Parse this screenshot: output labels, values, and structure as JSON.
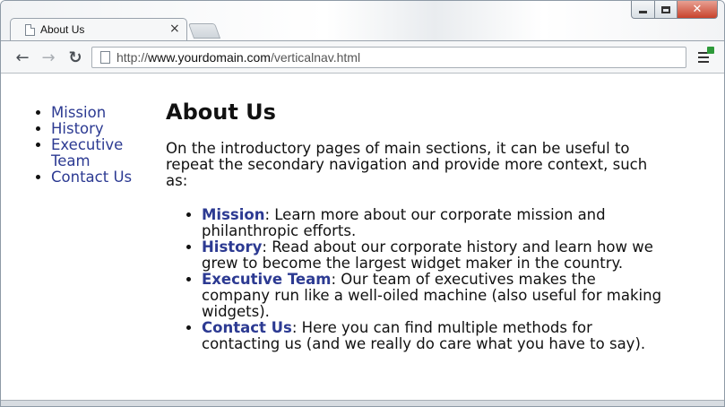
{
  "browser": {
    "tab_title": "About Us",
    "tab_close": "×",
    "url_scheme": "http://",
    "url_host": "www.yourdomain.com",
    "url_path": "/verticalnav.html"
  },
  "icons": {
    "back": "back-arrow-icon",
    "forward": "forward-arrow-icon",
    "reload": "reload-icon",
    "page": "page-icon",
    "menu": "menu-icon"
  },
  "sidenav": {
    "items": [
      {
        "label": "Mission"
      },
      {
        "label": "History"
      },
      {
        "label": "Executive Team"
      },
      {
        "label": "Contact Us"
      }
    ]
  },
  "main": {
    "heading": "About Us",
    "intro": "On the introductory pages of main sections, it can be useful to repeat the secondary navigation and provide more context, such as:",
    "items": [
      {
        "link": "Mission",
        "text": ": Learn more about our corporate mission and philanthropic efforts."
      },
      {
        "link": "History",
        "text": ": Read about our corporate history and learn how we grew to become the largest widget maker in the country."
      },
      {
        "link": "Executive Team",
        "text": ": Our team of executives makes the company run like a well-oiled machine (also useful for making widgets)."
      },
      {
        "link": "Contact Us",
        "text": ": Here you can find multiple methods for contacting us (and we really do care what you have to say)."
      }
    ]
  },
  "colors": {
    "link": "#2c3a92",
    "close_button": "#c8432c"
  }
}
